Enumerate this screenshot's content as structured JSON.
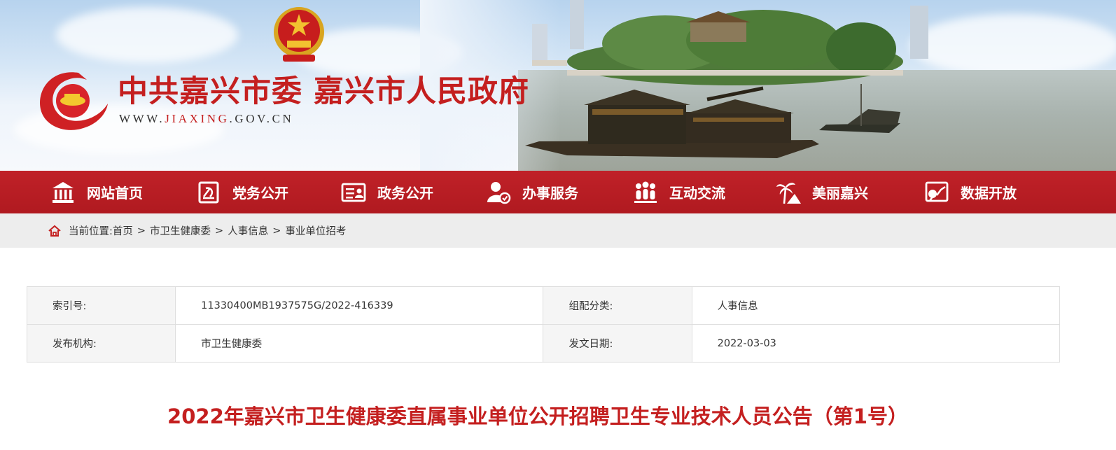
{
  "header": {
    "title": "中共嘉兴市委 嘉兴市人民政府",
    "url_prefix": "WWW.",
    "url_highlight": "JIAXING",
    "url_suffix": ".GOV.CN"
  },
  "nav": {
    "items": [
      {
        "label": "网站首页",
        "icon": "temple-home-icon"
      },
      {
        "label": "党务公开",
        "icon": "party-flag-icon"
      },
      {
        "label": "政务公开",
        "icon": "id-card-icon"
      },
      {
        "label": "办事服务",
        "icon": "person-service-icon"
      },
      {
        "label": "互动交流",
        "icon": "group-people-icon"
      },
      {
        "label": "美丽嘉兴",
        "icon": "palm-tree-icon"
      },
      {
        "label": "数据开放",
        "icon": "data-chart-icon"
      }
    ]
  },
  "breadcrumb": {
    "prefix": "当前位置:",
    "items": [
      "首页",
      "市卫生健康委",
      "人事信息",
      "事业单位招考"
    ],
    "separator": ">"
  },
  "meta": {
    "index_label": "索引号:",
    "index_value": "11330400MB1937575G/2022-416339",
    "category_label": "组配分类:",
    "category_value": "人事信息",
    "publisher_label": "发布机构:",
    "publisher_value": "市卫生健康委",
    "date_label": "发文日期:",
    "date_value": "2022-03-03"
  },
  "article": {
    "title": "2022年嘉兴市卫生健康委直属事业单位公开招聘卫生专业技术人员公告（第1号）"
  },
  "colors": {
    "brand_red": "#c41f1f",
    "nav_red": "#b81e24",
    "crumb_bg": "#ededed"
  }
}
